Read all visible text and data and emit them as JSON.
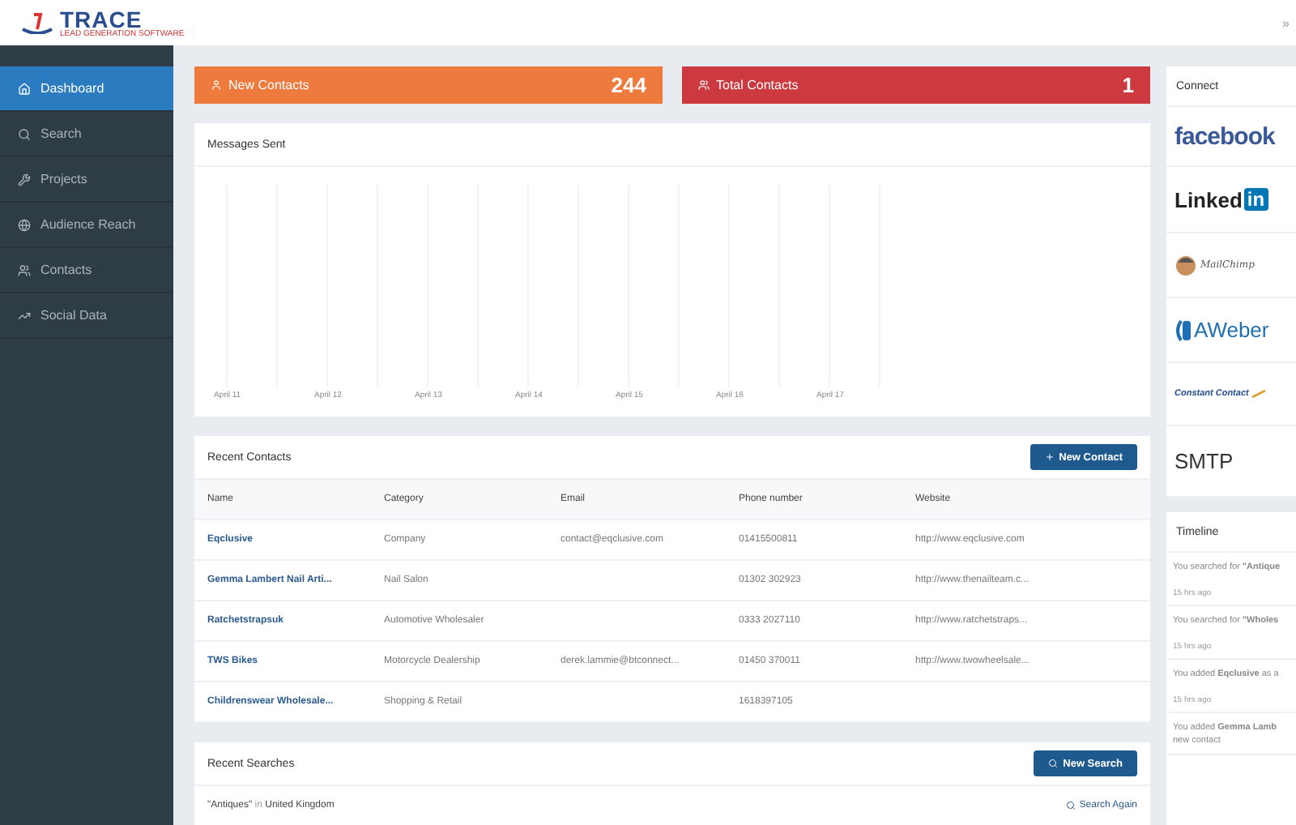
{
  "header": {
    "logo_title": "TRACE",
    "logo_subtitle": "LEAD GENERATION SOFTWARE",
    "expand": "»"
  },
  "sidebar": {
    "items": [
      {
        "label": "Dashboard",
        "kind": "home",
        "selected": true
      },
      {
        "label": "Search",
        "kind": "search",
        "selected": false
      },
      {
        "label": "Projects",
        "kind": "wrench",
        "selected": false
      },
      {
        "label": "Audience Reach",
        "kind": "globe",
        "selected": false
      },
      {
        "label": "Contacts",
        "kind": "users",
        "selected": false
      },
      {
        "label": "Social Data",
        "kind": "chart",
        "selected": false
      }
    ]
  },
  "stats": [
    {
      "label": "New Contacts",
      "value": "244",
      "kind": "user",
      "color": "#ee7a3e"
    },
    {
      "label": "Total Contacts",
      "value": "1",
      "kind": "users",
      "color": "#cc3a3f"
    }
  ],
  "messages_sent": {
    "title": "Messages Sent",
    "x_labels": [
      "April 11",
      "April 12",
      "April 13",
      "April 14",
      "April 15",
      "April 16",
      "April 17"
    ]
  },
  "recent_contacts": {
    "title": "Recent Contacts",
    "button": "New Contact",
    "columns": [
      "Name",
      "Category",
      "Email",
      "Phone number",
      "Website"
    ],
    "rows": [
      [
        "Eqclusive",
        "Company",
        "contact@eqclusive.com",
        "01415500811",
        "http://www.eqclusive.com"
      ],
      [
        "Gemma Lambert Nail Arti...",
        "Nail Salon",
        "",
        "01302 302923",
        "http://www.thenailteam.c..."
      ],
      [
        "Ratchetstrapsuk",
        "Automotive Wholesaler",
        "",
        "0333 2027110",
        "http://www.ratchetstraps..."
      ],
      [
        "TWS Bikes",
        "Motorcycle Dealership",
        "derek.lammie@btconnect...",
        "01450 370011",
        "http://www.twowheelsale..."
      ],
      [
        "Childrenswear Wholesale...",
        "Shopping & Retail",
        "",
        "1618397105",
        ""
      ]
    ]
  },
  "recent_searches": {
    "title": "Recent Searches",
    "button": "New Search",
    "rows": [
      {
        "query": "\"Antiques\"",
        "in": "in",
        "place": "United Kingdom",
        "action": "Search Again"
      }
    ]
  },
  "connect": {
    "title": "Connect",
    "items": [
      {
        "kind": "facebook",
        "label": "facebook"
      },
      {
        "kind": "linkedin",
        "label": "Linked",
        "badge": "in"
      },
      {
        "kind": "mailchimp",
        "label": "MailChimp"
      },
      {
        "kind": "aweber",
        "label": "AWeber"
      },
      {
        "kind": "constant",
        "label": "Constant Contact"
      },
      {
        "kind": "smtp",
        "label": "SMTP"
      }
    ]
  },
  "timeline": {
    "title": "Timeline",
    "items": [
      {
        "text": "You searched for **\"Antique**",
        "time": "15 hrs ago"
      },
      {
        "text": "You searched for **\"Wholes**",
        "time": "15 hrs ago"
      },
      {
        "text": "You added **Eqclusive** as a",
        "time": "15 hrs ago"
      },
      {
        "text": "You added **Gemma Lamb** new contact"
      }
    ]
  }
}
